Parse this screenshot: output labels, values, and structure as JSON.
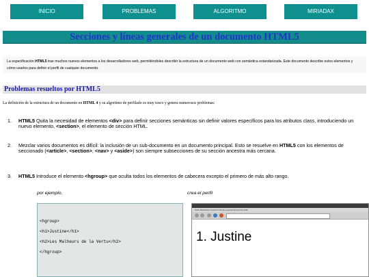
{
  "nav": [
    "INICIO",
    "PROBLEMAS",
    "ALGORITMO",
    "MIRIADAX"
  ],
  "banner": "Secciones y líneas generales de un documento HTML5",
  "intro": {
    "pre": "La especificación ",
    "bold": "HTML5",
    "post": " trae muchos nuevos elementos a los desarrolladores web, permitiéndoles describir la estructura de un documento web con semántica estandarizada. Este documento describe estos elementos y cómo usarlos para definir el perfil de cualquier documento."
  },
  "section_title": "Problemas resueltos por HTML5",
  "lead": {
    "pre": "La definición de la estructura de un documento en ",
    "bold": "HTML 4",
    "post": " y su algoritmo de perfilado es muy tosco y genera numerosos problemas:"
  },
  "items": [
    {
      "num": "1.",
      "b1": "HTML5",
      "t1": " Quita la necesidad de elementos ",
      "c1": "<div>",
      "t2": " para definir secciones semánticas sin definir valores específicos para los atributos class, introduciendo un nuevo elemento, ",
      "c2": "<section>",
      "t3": ", el elemento de sección HTML."
    },
    {
      "num": "2.",
      "t1": "Mezclar varios documentos es difícil: la inclusión de un sub-documento en un documento principal. Esto se resuelve en ",
      "b1": "HTML5",
      "t2": " con los elementos de seccionado (",
      "c1": "<article>",
      "s1": ", ",
      "c2": "<section>",
      "s2": ", ",
      "c3": "<nav>",
      "s3": " y ",
      "c4": "<aside>",
      "t3": ") son siempre subsecciones de su sección ancestra más cercana."
    },
    {
      "num": "3.",
      "b1": "HTML5",
      "t1": " Introduce el elemento ",
      "c1": "<hgroup>",
      "t2": " que oculta todos los elementos de cabecera excepto el primero de más alto rango."
    }
  ],
  "captions": {
    "left": "por ejemplo,",
    "right": "crea el perfil"
  },
  "code_lines": [
    "<hgroup>",
    "<h1>Justine</h1>",
    "<h2>Les Malheurs de la Vertu</h2>",
    "</hgroup>"
  ],
  "browser": {
    "menu": "Datei   Bearbeiten   Ansicht   Chronik   Lesezeichen   Extras   Hilfe",
    "heading": "1. Justine"
  }
}
